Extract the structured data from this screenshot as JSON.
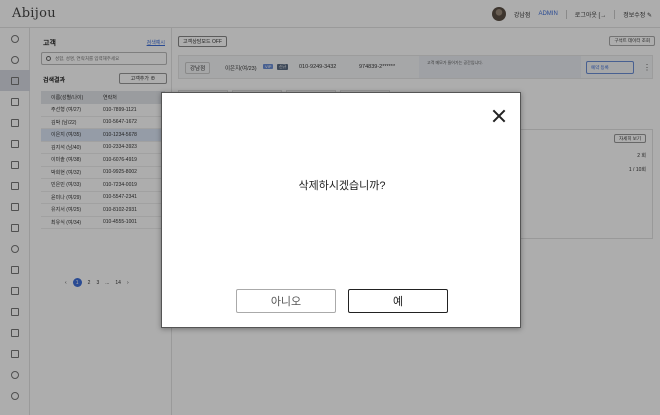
{
  "app": {
    "logo": "Abijou"
  },
  "header": {
    "user_name": "강남점",
    "role": "ADMIN",
    "logout": "로그아웃 [→",
    "edit_info": "정보수정 ✎"
  },
  "nav": {
    "icons": [
      "home-icon",
      "user-icon",
      "customer-icon",
      "consult-icon",
      "file-icon",
      "ticket-icon",
      "payment-icon",
      "calendar-icon",
      "gift-icon",
      "chart-icon",
      "settings-icon",
      "stats-icon",
      "org-icon",
      "list-icon",
      "sms-icon",
      "bar-icon",
      "people-icon",
      "profile-icon",
      "help-icon"
    ]
  },
  "panel": {
    "title": "고객",
    "hint": "검색예시",
    "search_placeholder": "성함, 성명, 연락처를 입력해주세요",
    "results_label": "검색결과",
    "add_button": "고객추가 ⊕",
    "columns": [
      "이름(성별/나이)",
      "연락처"
    ],
    "rows": [
      {
        "name": "주선형 (여/27)",
        "phone": "010-7899-1121"
      },
      {
        "name": "김박 (남/22)",
        "phone": "010-5647-1672"
      },
      {
        "name": "이은지 (여/35)",
        "phone": "010-1234-5678"
      },
      {
        "name": "김지석 (남/40)",
        "phone": "010-2334-3923"
      },
      {
        "name": "이미솔 (여/38)",
        "phone": "010-6076-4919"
      },
      {
        "name": "박희현 (여/32)",
        "phone": "010-9925-8002"
      },
      {
        "name": "민은민 (여/33)",
        "phone": "010-7234-0019"
      },
      {
        "name": "윤미나 (여/29)",
        "phone": "010-5547-2341"
      },
      {
        "name": "유지서 (여/25)",
        "phone": "010-8102-2931"
      },
      {
        "name": "최유식 (여/34)",
        "phone": "010-4555-1001"
      }
    ],
    "pager": {
      "prev": "‹",
      "pages": [
        "1",
        "2",
        "3",
        "...",
        "14"
      ],
      "next": "›"
    }
  },
  "content": {
    "consult_mode": "고객상담모드 OFF",
    "view_all": "구석트 데이터 조회",
    "manager": "강남점",
    "customer_name": "이은지(여/23)",
    "tag_vip": "VIP",
    "tag_new": "신규",
    "phone": "010-9249-3432",
    "rrn": "974839-2******",
    "memo": "고객 메모가 들어가는 공간입니다.",
    "booking": "예약 등록",
    "more_button": "자세히 보기",
    "count1": "2 회",
    "count2": "1 / 10회"
  },
  "modal": {
    "message": "삭제하시겠습니까?",
    "no": "아니오",
    "yes": "예"
  }
}
